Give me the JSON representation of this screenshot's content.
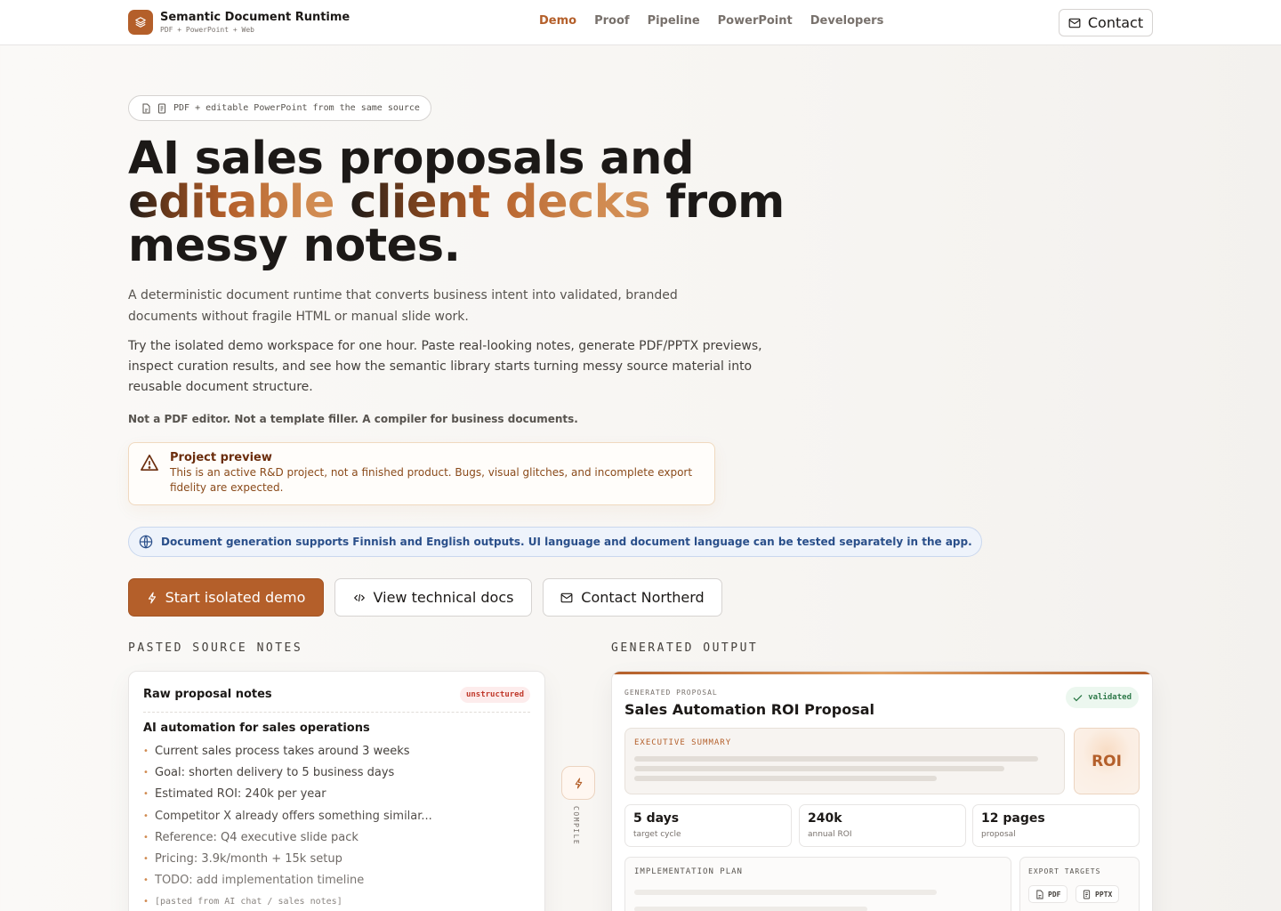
{
  "header": {
    "brand_title": "Semantic Document Runtime",
    "brand_subtitle": "PDF + PowerPoint + Web",
    "nav": [
      {
        "label": "Demo",
        "active": true
      },
      {
        "label": "Proof"
      },
      {
        "label": "Pipeline"
      },
      {
        "label": "PowerPoint"
      },
      {
        "label": "Developers"
      }
    ],
    "contact_label": "Contact"
  },
  "hero": {
    "pill": "PDF + editable PowerPoint from the same source",
    "title_line1": "AI sales proposals and",
    "title_line2_a": "editable ",
    "title_line2_accent": "client decks",
    "title_line2_b": " from",
    "title_line3": "messy notes.",
    "lead": "A deterministic document runtime that converts business intent into validated, branded documents without fragile HTML or manual slide work.",
    "lead2": "Try the isolated demo workspace for one hour. Paste real-looking notes, generate PDF/PPTX previews, inspect curation results, and see how the semantic library starts turning messy source material into reusable document structure.",
    "tagline": "Not a PDF editor. Not a template filler. A compiler for business documents."
  },
  "warning": {
    "title": "Project preview",
    "text": "This is an active R&D project, not a finished product. Bugs, visual glitches, and incomplete export fidelity are expected."
  },
  "language_note": "Document generation supports Finnish and English outputs. UI language and document language can be tested separately in the app.",
  "actions": {
    "primary": "Start isolated demo",
    "docs": "View technical docs",
    "contact": "Contact Northerd"
  },
  "source": {
    "section_label": "PASTED SOURCE NOTES",
    "card_title": "Raw proposal notes",
    "badge": "unstructured",
    "notes_title": "AI automation for sales operations",
    "items": [
      "Current sales process takes around 3 weeks",
      "Goal: shorten delivery to 5 business days",
      "Estimated ROI: 240k per year",
      "Competitor X already offers something similar...",
      "Reference: Q4 executive slide pack",
      "Pricing: 3.9k/month + 15k setup",
      "TODO: add implementation timeline"
    ],
    "source_tag": "[pasted from AI chat / sales notes]"
  },
  "compile_label": "COMPILE",
  "output": {
    "section_label": "GENERATED OUTPUT",
    "kicker": "GENERATED PROPOSAL",
    "title": "Sales Automation ROI Proposal",
    "status": "validated",
    "exec_label": "EXECUTIVE SUMMARY",
    "roi_label": "ROI",
    "stats": [
      {
        "value": "5 days",
        "label": "target cycle"
      },
      {
        "value": "240k",
        "label": "annual ROI"
      },
      {
        "value": "12 pages",
        "label": "proposal"
      }
    ],
    "impl_label": "IMPLEMENTATION PLAN",
    "export_label": "EXPORT TARGETS",
    "export_targets": [
      "PDF",
      "PPTX"
    ]
  },
  "colors": {
    "accent": "#b45f2a",
    "info": "#2a4f8a",
    "success": "#2f7a4a",
    "danger": "#c0392b"
  }
}
